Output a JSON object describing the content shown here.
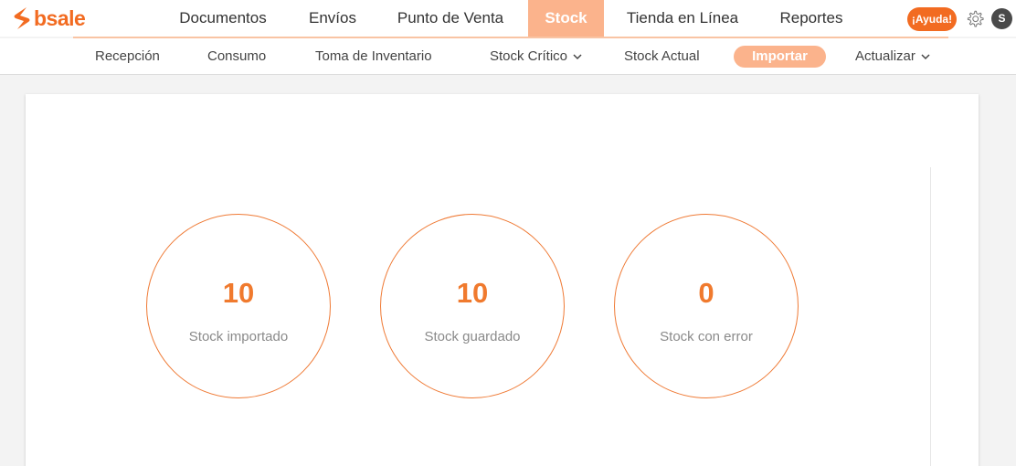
{
  "brand": {
    "name": "bsale",
    "color": "#f26b21"
  },
  "main_nav": [
    {
      "label": "Documentos"
    },
    {
      "label": "Envíos"
    },
    {
      "label": "Punto de Venta"
    },
    {
      "label": "Stock",
      "active": true
    },
    {
      "label": "Tienda en Línea"
    },
    {
      "label": "Reportes"
    }
  ],
  "header": {
    "help_label": "¡Ayuda!",
    "settings_icon": "gear-icon",
    "avatar_initial": "S"
  },
  "sub_nav": [
    {
      "label": "Recepción"
    },
    {
      "label": "Consumo"
    },
    {
      "label": "Toma de Inventario"
    },
    {
      "label": "Stock Crítico",
      "dropdown": true
    },
    {
      "label": "Stock Actual"
    },
    {
      "label": "Importar",
      "active": true
    },
    {
      "label": "Actualizar",
      "dropdown": true
    }
  ],
  "stats": [
    {
      "value": "10",
      "label": "Stock importado"
    },
    {
      "value": "10",
      "label": "Stock guardado"
    },
    {
      "value": "0",
      "label": "Stock con error"
    }
  ],
  "colors": {
    "accent": "#f26b21",
    "active_tab": "#fbb38c",
    "stat_number": "#f07a2e",
    "stat_border": "#ef7a35"
  }
}
